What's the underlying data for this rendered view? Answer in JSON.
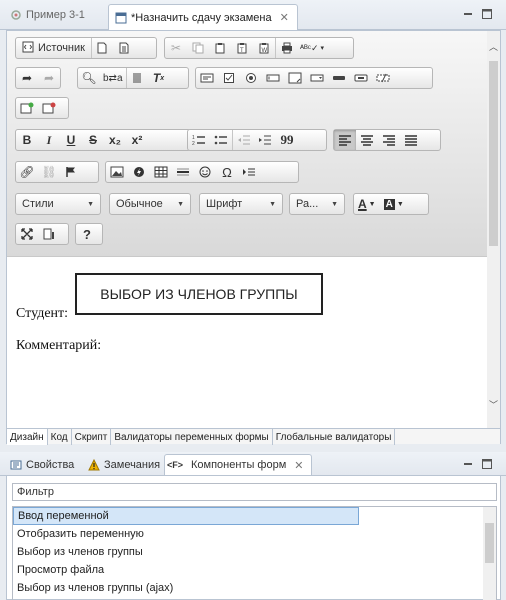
{
  "editor_tabs": [
    {
      "label": "Пример 3-1",
      "active": false
    },
    {
      "label": "*Назначить сдачу экзамена",
      "active": true
    }
  ],
  "toolbar": {
    "source_label": "Источник",
    "styles_label": "Стили",
    "format_label": "Обычное",
    "font_label": "Шрифт",
    "size_label": "Ра...",
    "bold": "B",
    "italic": "I",
    "underline": "U",
    "strike": "S",
    "subscript": "x₂",
    "superscript": "x²",
    "blockquote": "99",
    "help": "?",
    "omega": "Ω",
    "text_color": "A",
    "bg_color": "A"
  },
  "content": {
    "select_box_text": "ВЫБОР ИЗ ЧЛЕНОВ ГРУППЫ",
    "student_label": "Студент:",
    "comment_label": "Комментарий:"
  },
  "bottom_tabs": [
    "Дизайн",
    "Код",
    "Скрипт",
    "Валидаторы переменных формы",
    "Глобальные валидаторы"
  ],
  "view_tabs": [
    {
      "label": "Свойства",
      "icon": "properties-icon",
      "active": false
    },
    {
      "label": "Замечания",
      "icon": "warning-icon",
      "active": false
    },
    {
      "label": "Компоненты форм",
      "icon": "form-components-icon",
      "active": true
    }
  ],
  "filter": {
    "placeholder": "Фильтр"
  },
  "components": [
    "Ввод переменной",
    "Отобразить переменную",
    "Выбор из членов группы",
    "Просмотр файла",
    "Выбор из членов группы (ajax)"
  ],
  "colors": {
    "accent": "#7aa7d6",
    "selection": "#d4e6f8",
    "warning": "#f0b400"
  }
}
